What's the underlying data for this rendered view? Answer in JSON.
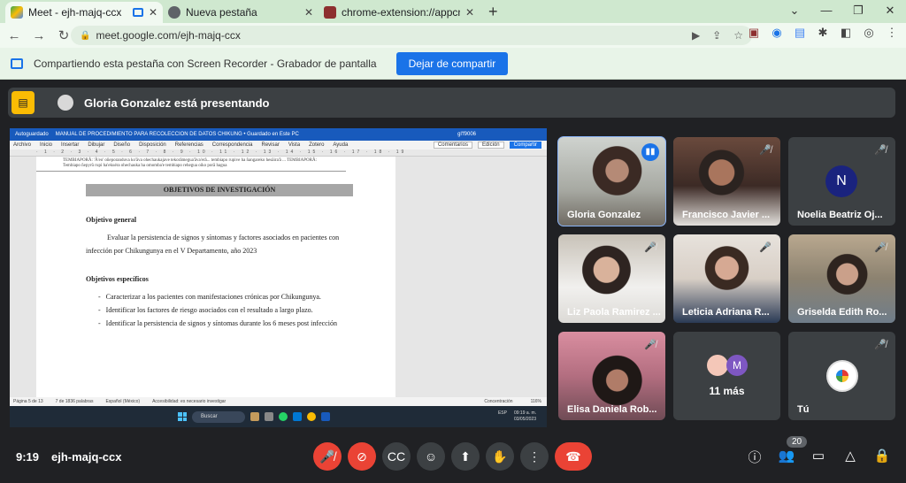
{
  "browser": {
    "tabs": [
      {
        "title": "Meet - ejh-majq-ccx",
        "active": true
      },
      {
        "title": "Nueva pestaña",
        "active": false
      },
      {
        "title": "chrome-extension://appcnhiefcic",
        "active": false
      }
    ],
    "url": "meet.google.com/ejh-majq-ccx"
  },
  "sharing_bar": {
    "message": "Compartiendo esta pestaña con Screen Recorder - Grabador de pantalla",
    "stop_button": "Dejar de compartir"
  },
  "meet": {
    "presenting_text": "Gloria Gonzalez está presentando",
    "presentation": {
      "toolbar": {
        "autosave": "Autoguardado",
        "doc_title": "MANUAL DE PROCEDIMIENTO PARA RECOLECCION DE DATOS CHIKUNG • Guardado en Este PC",
        "user": "gl'f9006"
      },
      "menu": [
        "Archivo",
        "Inicio",
        "Insertar",
        "Dibujar",
        "Diseño",
        "Disposición",
        "Referencias",
        "Correspondencia",
        "Revisar",
        "Vista",
        "Zotero",
        "Ayuda"
      ],
      "menu_right": {
        "comments": "Comentarios",
        "editing": "Edición",
        "share": "Compartir"
      },
      "cut_text": "TEMBIAPORÃ: 'Ã'eo' oñeporanduva ko'ãva ohechaukajave tekorãmegua'ãva'erã... tembiapo rupive ha ñangareko hesãira'ã ... TEMBIAPORÃ: Tembiapo ñepyrũ rupi ha'ekuéra ohechauka ha omomba'e tembiapo rehegua oiko porã hagua",
      "heading": "OBJETIVOS DE INVESTIGACIÓN",
      "general_title": "Objetivo general",
      "general_text": "Evaluar la persistencia de signos y síntomas y factores asociados en pacientes con infección por Chikungunya en el V Departamento, año 2023",
      "specific_title": "Objetivos específicos",
      "specific_items": [
        "Caracterizar a los pacientes con manifestaciones crónicas por Chikungunya.",
        "Identificar los factores de riesgo asociados con el resultado a largo plazo.",
        "Identificar la persistencia de signos y síntomas durante los 6 meses post infección"
      ],
      "status": {
        "page": "Página 5 de 13",
        "words": "7 de 1836 palabras",
        "lang": "Español (México)",
        "access": "Accesibilidad: es necesario investigar",
        "focus": "Concentración",
        "zoom": "116%"
      },
      "taskbar": {
        "search": "Buscar",
        "lang": "ESP",
        "time": "09:19 a. m.",
        "date": "03/05/2023"
      }
    },
    "participants": [
      {
        "name": "Gloria Gonzalez",
        "speaking": true
      },
      {
        "name": "Francisco Javier ...",
        "speaking": false
      },
      {
        "name": "Noelia Beatriz Oj...",
        "initial": "N",
        "speaking": false
      },
      {
        "name": "Liz Paola Ramirez ...",
        "speaking": false
      },
      {
        "name": "Leticia Adriana R...",
        "speaking": false
      },
      {
        "name": "Griselda Edith Ro...",
        "speaking": false
      },
      {
        "name": "Elisa Daniela Rob...",
        "speaking": false
      }
    ],
    "more": {
      "initial": "M",
      "count": "11 más"
    },
    "you": {
      "name": "Tú"
    },
    "bottom": {
      "time": "9:19",
      "code": "ejh-majq-ccx",
      "participant_count": "20"
    }
  }
}
